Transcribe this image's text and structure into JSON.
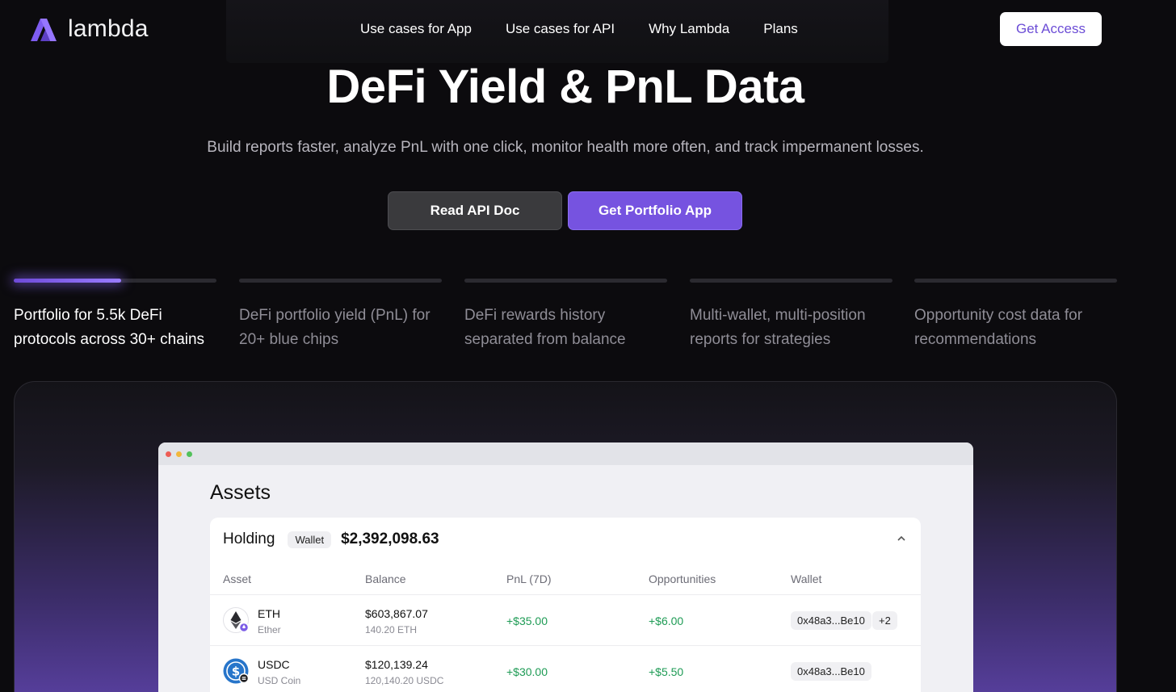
{
  "brand": {
    "name": "lambda",
    "accent": "#7653e0"
  },
  "nav": {
    "links": [
      "Use cases for App",
      "Use cases for API",
      "Why Lambda",
      "Plans"
    ],
    "cta": "Get Access"
  },
  "hero": {
    "title": "DeFi Yield & PnL Data",
    "subtitle": "Build reports faster, analyze PnL with one click, monitor health more often, and track impermanent losses.",
    "primary_button": "Get Portfolio App",
    "secondary_button": "Read API Doc"
  },
  "features": [
    {
      "label": "Portfolio for 5.5k DeFi protocols across 30+ chains",
      "active": true,
      "progress": 0.53
    },
    {
      "label": "DeFi portfolio yield (PnL) for 20+ blue chips",
      "active": false,
      "progress": 0
    },
    {
      "label": "DeFi rewards history separated from balance",
      "active": false,
      "progress": 0
    },
    {
      "label": "Multi-wallet, multi-position reports for strategies",
      "active": false,
      "progress": 0
    },
    {
      "label": "Opportunity cost data for recommendations",
      "active": false,
      "progress": 0
    }
  ],
  "app": {
    "section_title": "Assets",
    "holding": {
      "label": "Holding",
      "badge": "Wallet",
      "total": "$2,392,098.63",
      "icon": "chevron-up-icon"
    },
    "columns": [
      "Asset",
      "Balance",
      "PnL (7D)",
      "Opportunities",
      "Wallet"
    ],
    "rows": [
      {
        "symbol": "ETH",
        "name": "Ether",
        "balance": "$603,867.07",
        "balance_units": "140.20 ETH",
        "pnl": "+$35.00",
        "opportunities": "+$6.00",
        "wallet": "0x48a3...Be10",
        "extra_wallets": "+2",
        "icon": "ethereum-icon"
      },
      {
        "symbol": "USDC",
        "name": "USD Coin",
        "balance": "$120,139.24",
        "balance_units": "120,140.20 USDC",
        "pnl": "+$30.00",
        "opportunities": "+$5.50",
        "wallet": "0x48a3...Be10",
        "icon": "usdc-icon"
      }
    ]
  }
}
